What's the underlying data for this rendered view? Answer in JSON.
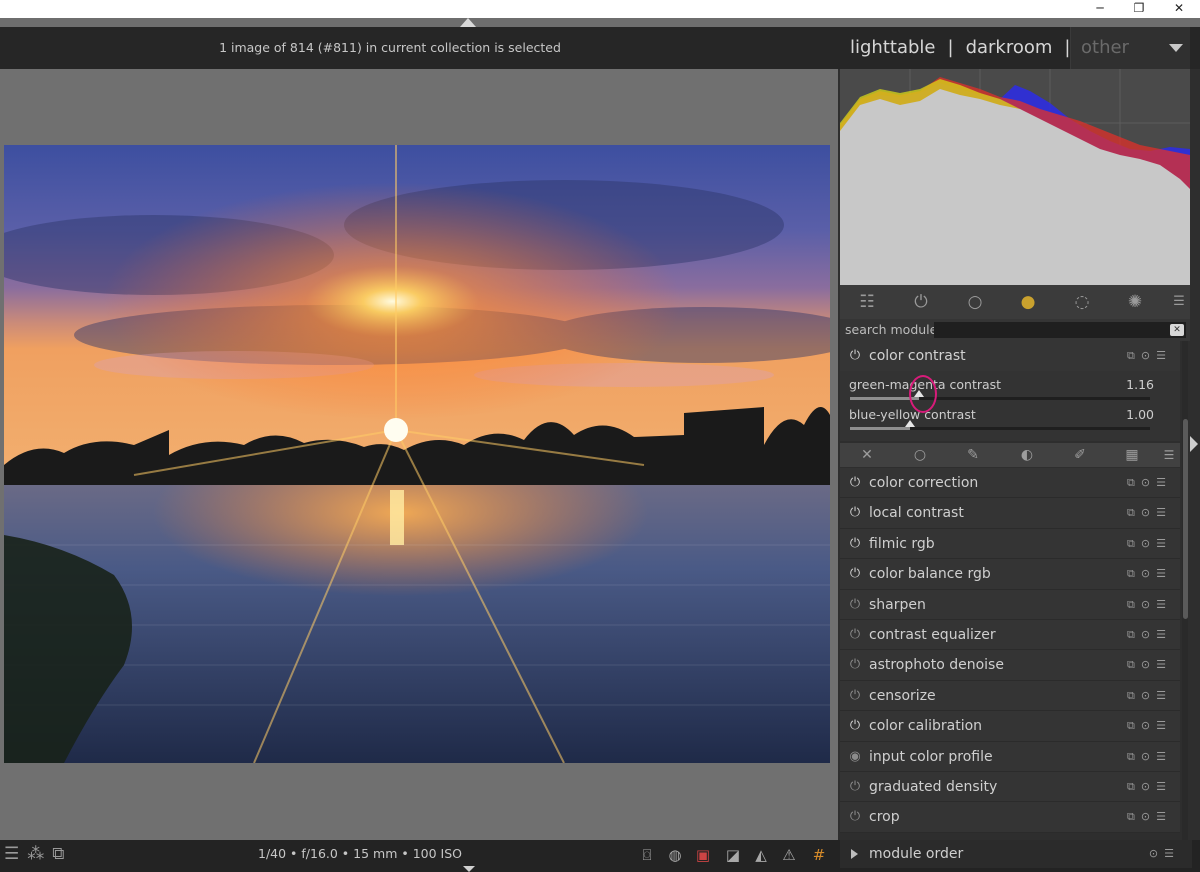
{
  "header": {
    "collection_info": "1 image of 814 (#811) in current collection is selected",
    "views": {
      "lighttable": "lighttable",
      "separator": "|",
      "darkroom": "darkroom",
      "other": "other"
    }
  },
  "window_controls": {
    "minimize": "─",
    "maximize": "❐",
    "close": "✕"
  },
  "module_panel": {
    "search_label": "search module",
    "search_value": "",
    "active_module": {
      "title": "color contrast",
      "sliders": [
        {
          "label": "green-magenta contrast",
          "value": "1.16",
          "fraction": 0.23
        },
        {
          "label": "blue-yellow contrast",
          "value": "1.00",
          "fraction": 0.2
        }
      ]
    },
    "modules": [
      {
        "title": "color correction",
        "enabled": true
      },
      {
        "title": "local contrast",
        "enabled": true
      },
      {
        "title": "filmic rgb",
        "enabled": true
      },
      {
        "title": "color balance rgb",
        "enabled": true
      },
      {
        "title": "sharpen",
        "enabled": false
      },
      {
        "title": "contrast equalizer",
        "enabled": false
      },
      {
        "title": "astrophoto denoise",
        "enabled": false
      },
      {
        "title": "censorize",
        "enabled": false
      },
      {
        "title": "color calibration",
        "enabled": true
      },
      {
        "title": "input color profile",
        "enabled": "always"
      },
      {
        "title": "graduated density",
        "enabled": false
      },
      {
        "title": "crop",
        "enabled": false
      }
    ],
    "module_order": "module order"
  },
  "exif": "1/40 • f/16.0 • 15 mm • 100 ISO",
  "colors": {
    "panel": "#2e2e2e",
    "header": "#262626",
    "accent_cursor": "#d81b7a"
  }
}
